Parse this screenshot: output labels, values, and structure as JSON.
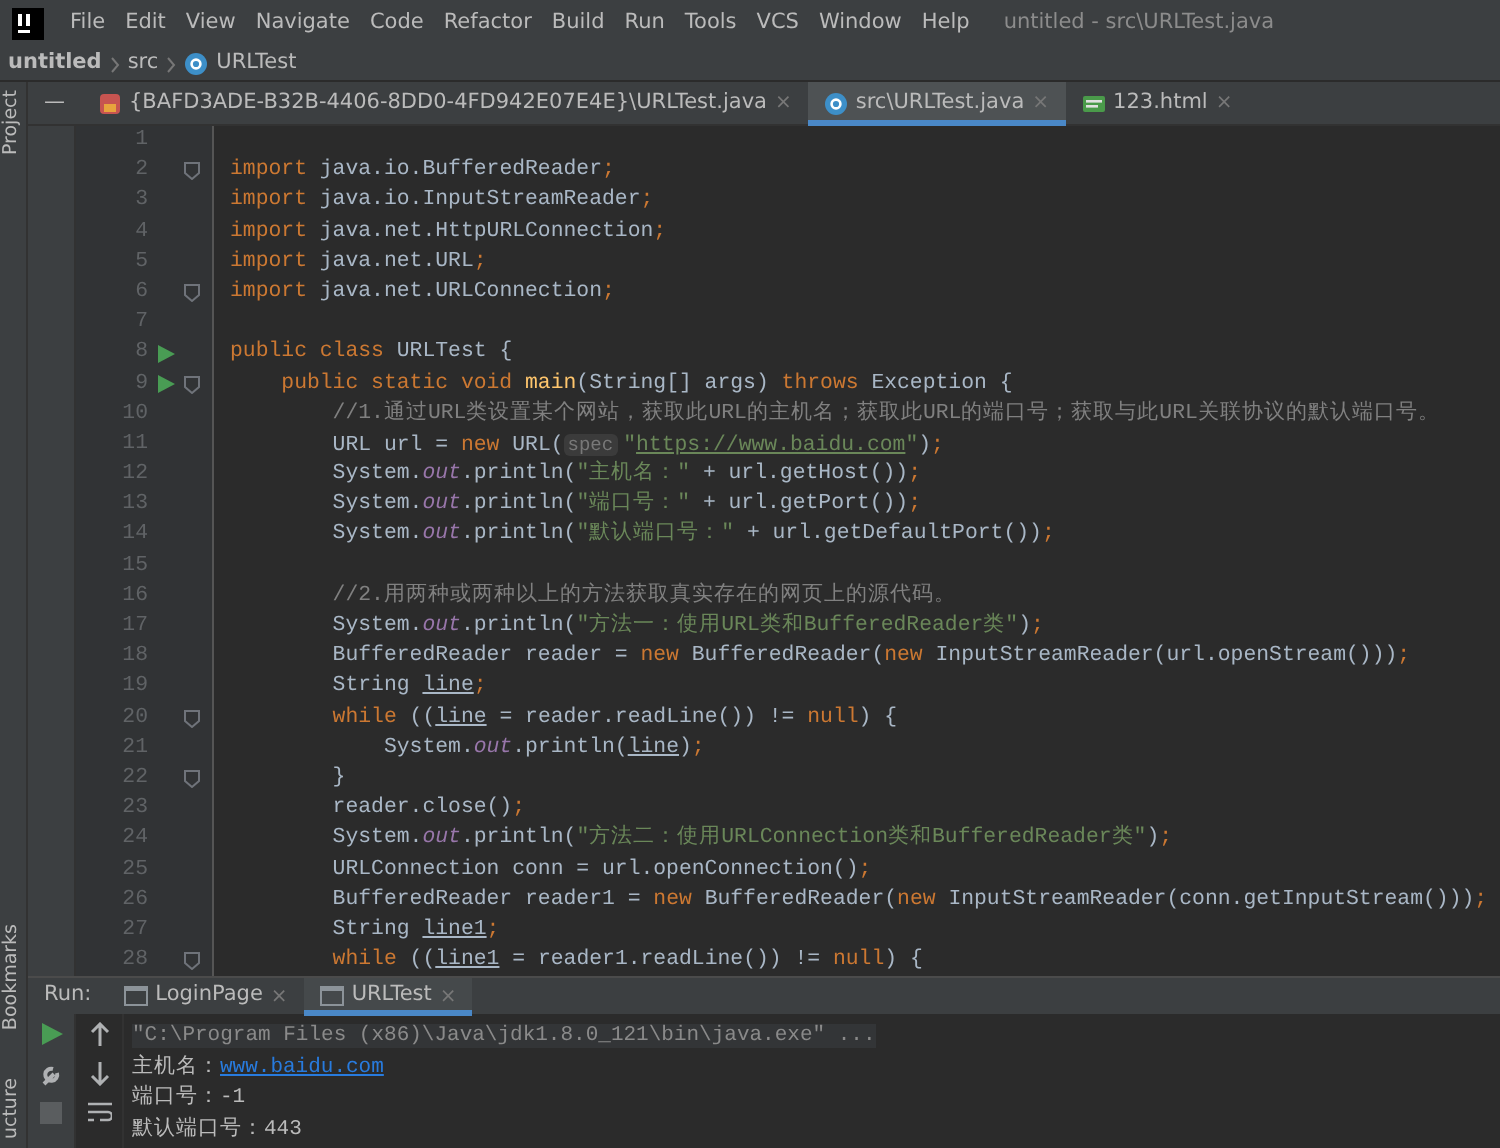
{
  "menu_bar": {
    "items": [
      "File",
      "Edit",
      "View",
      "Navigate",
      "Code",
      "Refactor",
      "Build",
      "Run",
      "Tools",
      "VCS",
      "Window",
      "Help"
    ],
    "window_title": "untitled - src\\URLTest.java"
  },
  "breadcrumb": {
    "project": "untitled",
    "folder": "src",
    "file": "URLTest"
  },
  "tool_strip": {
    "top": "Project",
    "bottom": [
      "Bookmarks",
      "ucture"
    ]
  },
  "editor_tabs_minimize": "—",
  "close_glyph": "×",
  "editor_tabs": [
    {
      "label": "{BAFD3ADE-B32B-4406-8DD0-4FD942E07E4E}\\URLTest.java",
      "kind": "java",
      "selected": false
    },
    {
      "label": "src\\URLTest.java",
      "kind": "class",
      "selected": true
    },
    {
      "label": "123.html",
      "kind": "html",
      "selected": false
    }
  ],
  "code_lines": [
    {
      "number": "1",
      "run": false,
      "fold": false
    },
    {
      "number": "2",
      "run": false,
      "fold": true,
      "tokens": [
        {
          "kind": "kw",
          "text": "import"
        },
        {
          "kind": "plain",
          "text": " java.io.BufferedReader"
        },
        {
          "kind": "punct",
          "text": ";"
        }
      ]
    },
    {
      "number": "3",
      "run": false,
      "fold": false,
      "tokens": [
        {
          "kind": "kw",
          "text": "import"
        },
        {
          "kind": "plain",
          "text": " java.io.InputStreamReader"
        },
        {
          "kind": "punct",
          "text": ";"
        }
      ]
    },
    {
      "number": "4",
      "run": false,
      "fold": false,
      "tokens": [
        {
          "kind": "kw",
          "text": "import"
        },
        {
          "kind": "plain",
          "text": " java.net.HttpURLConnection"
        },
        {
          "kind": "punct",
          "text": ";"
        }
      ]
    },
    {
      "number": "5",
      "run": false,
      "fold": false,
      "tokens": [
        {
          "kind": "kw",
          "text": "import"
        },
        {
          "kind": "plain",
          "text": " java.net.URL"
        },
        {
          "kind": "punct",
          "text": ";"
        }
      ]
    },
    {
      "number": "6",
      "run": false,
      "fold": true,
      "tokens": [
        {
          "kind": "kw",
          "text": "import"
        },
        {
          "kind": "plain",
          "text": " java.net.URLConnection"
        },
        {
          "kind": "punct",
          "text": ";"
        }
      ]
    },
    {
      "number": "7",
      "run": false,
      "fold": false
    },
    {
      "number": "8",
      "run": true,
      "fold": false,
      "tokens": [
        {
          "kind": "kw",
          "text": "public class"
        },
        {
          "kind": "plain",
          "text": " URLTest {"
        }
      ]
    },
    {
      "number": "9",
      "run": true,
      "fold": true,
      "tokens": [
        {
          "kind": "kw",
          "text": "    public static void "
        },
        {
          "kind": "method",
          "text": "main"
        },
        {
          "kind": "plain",
          "text": "(String[] args) "
        },
        {
          "kind": "kw",
          "text": "throws"
        },
        {
          "kind": "plain",
          "text": " Exception {"
        }
      ]
    },
    {
      "number": "10",
      "run": false,
      "fold": false,
      "tokens": [
        {
          "kind": "comment",
          "text": "        //1.通过URL类设置某个网站，获取此URL的主机名；获取此URL的端口号；获取与此URL关联协议的默认端口号。"
        }
      ]
    },
    {
      "number": "11",
      "run": false,
      "fold": false,
      "tokens": [
        {
          "kind": "plain",
          "text": "        URL url = "
        },
        {
          "kind": "kw",
          "text": "new"
        },
        {
          "kind": "plain",
          "text": " URL("
        },
        {
          "kind": "hint",
          "text": "spec"
        },
        {
          "kind": "str",
          "text": "\""
        },
        {
          "kind": "link",
          "text": "https://www.baidu.com"
        },
        {
          "kind": "str",
          "text": "\""
        },
        {
          "kind": "plain",
          "text": ")"
        },
        {
          "kind": "punct",
          "text": ";"
        }
      ]
    },
    {
      "number": "12",
      "run": false,
      "fold": false,
      "tokens": [
        {
          "kind": "plain",
          "text": "        System."
        },
        {
          "kind": "field",
          "text": "out"
        },
        {
          "kind": "plain",
          "text": ".println("
        },
        {
          "kind": "str",
          "text": "\"主机名：\""
        },
        {
          "kind": "plain",
          "text": " + url.getHost())"
        },
        {
          "kind": "punct",
          "text": ";"
        }
      ]
    },
    {
      "number": "13",
      "run": false,
      "fold": false,
      "tokens": [
        {
          "kind": "plain",
          "text": "        System."
        },
        {
          "kind": "field",
          "text": "out"
        },
        {
          "kind": "plain",
          "text": ".println("
        },
        {
          "kind": "str",
          "text": "\"端口号：\""
        },
        {
          "kind": "plain",
          "text": " + url.getPort())"
        },
        {
          "kind": "punct",
          "text": ";"
        }
      ]
    },
    {
      "number": "14",
      "run": false,
      "fold": false,
      "tokens": [
        {
          "kind": "plain",
          "text": "        System."
        },
        {
          "kind": "field",
          "text": "out"
        },
        {
          "kind": "plain",
          "text": ".println("
        },
        {
          "kind": "str",
          "text": "\"默认端口号：\""
        },
        {
          "kind": "plain",
          "text": " + url.getDefaultPort())"
        },
        {
          "kind": "punct",
          "text": ";"
        }
      ]
    },
    {
      "number": "15",
      "run": false,
      "fold": false
    },
    {
      "number": "16",
      "run": false,
      "fold": false,
      "tokens": [
        {
          "kind": "comment",
          "text": "        //2.用两种或两种以上的方法获取真实存在的网页上的源代码。"
        }
      ]
    },
    {
      "number": "17",
      "run": false,
      "fold": false,
      "tokens": [
        {
          "kind": "plain",
          "text": "        System."
        },
        {
          "kind": "field",
          "text": "out"
        },
        {
          "kind": "plain",
          "text": ".println("
        },
        {
          "kind": "str",
          "text": "\"方法一：使用URL类和BufferedReader类\""
        },
        {
          "kind": "plain",
          "text": ")"
        },
        {
          "kind": "punct",
          "text": ";"
        }
      ]
    },
    {
      "number": "18",
      "run": false,
      "fold": false,
      "tokens": [
        {
          "kind": "plain",
          "text": "        BufferedReader reader = "
        },
        {
          "kind": "kw",
          "text": "new"
        },
        {
          "kind": "plain",
          "text": " BufferedReader("
        },
        {
          "kind": "kw",
          "text": "new"
        },
        {
          "kind": "plain",
          "text": " InputStreamReader(url.openStream()))"
        },
        {
          "kind": "punct",
          "text": ";"
        }
      ]
    },
    {
      "number": "19",
      "run": false,
      "fold": false,
      "tokens": [
        {
          "kind": "plain",
          "text": "        String "
        },
        {
          "kind": "var",
          "text": "line"
        },
        {
          "kind": "punct",
          "text": ";"
        }
      ]
    },
    {
      "number": "20",
      "run": false,
      "fold": true,
      "tokens": [
        {
          "kind": "kw",
          "text": "        while"
        },
        {
          "kind": "plain",
          "text": " (("
        },
        {
          "kind": "var",
          "text": "line"
        },
        {
          "kind": "plain",
          "text": " = reader.readLine()) != "
        },
        {
          "kind": "kw",
          "text": "null"
        },
        {
          "kind": "plain",
          "text": ") {"
        }
      ]
    },
    {
      "number": "21",
      "run": false,
      "fold": false,
      "tokens": [
        {
          "kind": "plain",
          "text": "            System."
        },
        {
          "kind": "field",
          "text": "out"
        },
        {
          "kind": "plain",
          "text": ".println("
        },
        {
          "kind": "var",
          "text": "line"
        },
        {
          "kind": "plain",
          "text": ")"
        },
        {
          "kind": "punct",
          "text": ";"
        }
      ]
    },
    {
      "number": "22",
      "run": false,
      "fold": true,
      "tokens": [
        {
          "kind": "plain",
          "text": "        }"
        }
      ]
    },
    {
      "number": "23",
      "run": false,
      "fold": false,
      "tokens": [
        {
          "kind": "plain",
          "text": "        reader.close()"
        },
        {
          "kind": "punct",
          "text": ";"
        }
      ]
    },
    {
      "number": "24",
      "run": false,
      "fold": false,
      "tokens": [
        {
          "kind": "plain",
          "text": "        System."
        },
        {
          "kind": "field",
          "text": "out"
        },
        {
          "kind": "plain",
          "text": ".println("
        },
        {
          "kind": "str",
          "text": "\"方法二：使用URLConnection类和BufferedReader类\""
        },
        {
          "kind": "plain",
          "text": ")"
        },
        {
          "kind": "punct",
          "text": ";"
        }
      ]
    },
    {
      "number": "25",
      "run": false,
      "fold": false,
      "tokens": [
        {
          "kind": "plain",
          "text": "        URLConnection conn = url.openConnection()"
        },
        {
          "kind": "punct",
          "text": ";"
        }
      ]
    },
    {
      "number": "26",
      "run": false,
      "fold": false,
      "tokens": [
        {
          "kind": "plain",
          "text": "        BufferedReader reader1 = "
        },
        {
          "kind": "kw",
          "text": "new"
        },
        {
          "kind": "plain",
          "text": " BufferedReader("
        },
        {
          "kind": "kw",
          "text": "new"
        },
        {
          "kind": "plain",
          "text": " InputStreamReader(conn.getInputStream()))"
        },
        {
          "kind": "punct",
          "text": ";"
        }
      ]
    },
    {
      "number": "27",
      "run": false,
      "fold": false,
      "tokens": [
        {
          "kind": "plain",
          "text": "        String "
        },
        {
          "kind": "var",
          "text": "line1"
        },
        {
          "kind": "punct",
          "text": ";"
        }
      ]
    },
    {
      "number": "28",
      "run": false,
      "fold": true,
      "tokens": [
        {
          "kind": "kw",
          "text": "        while"
        },
        {
          "kind": "plain",
          "text": " (("
        },
        {
          "kind": "var",
          "text": "line1"
        },
        {
          "kind": "plain",
          "text": " = reader1.readLine()) != "
        },
        {
          "kind": "kw",
          "text": "null"
        },
        {
          "kind": "plain",
          "text": ") {"
        }
      ]
    }
  ],
  "run_panel": {
    "label": "Run:",
    "tabs": [
      {
        "label": "LoginPage",
        "selected": false
      },
      {
        "label": "URLTest",
        "selected": true
      }
    ],
    "console": [
      {
        "kind": "command",
        "text": "\"C:\\Program Files (x86)\\Java\\jdk1.8.0_121\\bin\\java.exe\" ..."
      },
      {
        "kind": "link",
        "text": "主机名：",
        "link": "www.baidu.com"
      },
      {
        "kind": "text",
        "text": "端口号：-1"
      },
      {
        "kind": "text",
        "text": "默认端口号：443"
      }
    ]
  }
}
